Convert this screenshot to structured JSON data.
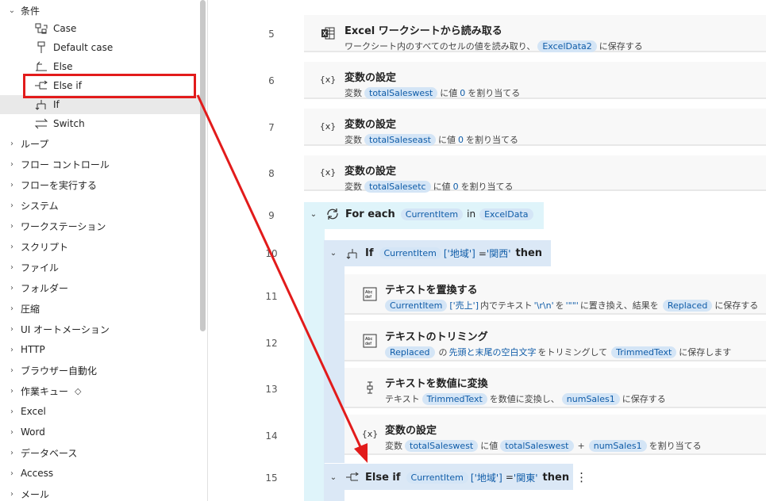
{
  "sidebar": {
    "conditions_label": "条件",
    "sub_items": [
      {
        "label": "Case",
        "icon": "case-icon"
      },
      {
        "label": "Default case",
        "icon": "default-case-icon"
      },
      {
        "label": "Else",
        "icon": "else-icon"
      },
      {
        "label": "Else if",
        "icon": "else-if-icon"
      },
      {
        "label": "If",
        "icon": "if-icon"
      },
      {
        "label": "Switch",
        "icon": "switch-icon"
      }
    ],
    "groups": [
      "ループ",
      "フロー コントロール",
      "フローを実行する",
      "システム",
      "ワークステーション",
      "スクリプト",
      "ファイル",
      "フォルダー",
      "圧縮",
      "UI オートメーション",
      "HTTP",
      "ブラウザー自動化",
      "作業キュー",
      "Excel",
      "Word",
      "データベース",
      "Access",
      "メール"
    ]
  },
  "main": {
    "line_numbers": [
      "5",
      "6",
      "7",
      "8",
      "9",
      "10",
      "11",
      "12",
      "13",
      "14",
      "15"
    ],
    "step5": {
      "title": "Excel ワークシートから読み取る",
      "desc_pre": "ワークシート内のすべてのセルの値を読み取り、",
      "var": "ExcelData2",
      "desc_post": "に保存する"
    },
    "step6": {
      "title": "変数の設定",
      "pre": "変数",
      "var": "totalSaleswest",
      "mid": "に値",
      "val": "0",
      "post": "を割り当てる"
    },
    "step7": {
      "title": "変数の設定",
      "pre": "変数",
      "var": "totalSaleseast",
      "mid": "に値",
      "val": "0",
      "post": "を割り当てる"
    },
    "step8": {
      "title": "変数の設定",
      "pre": "変数",
      "var": "totalSalesetc",
      "mid": "に値",
      "val": "0",
      "post": "を割り当てる"
    },
    "foreach": {
      "kw": "For each",
      "var": "CurrentItem",
      "in": "in",
      "list": "ExcelData"
    },
    "if": {
      "kw": "If",
      "var": "CurrentItem",
      "key": "['地域']",
      "op": "=",
      "value": "'関西'",
      "then": "then"
    },
    "step11": {
      "title": "テキストを置換する",
      "var": "CurrentItem",
      "key": "['売上']",
      "mid1": "内でテキスト",
      "find": "'\\r\\n'",
      "mid2": "を",
      "repl": "'\"\"'",
      "mid3": "に置き換え、結果を",
      "result": "Replaced",
      "post": "に保存する"
    },
    "step12": {
      "title": "テキストのトリミング",
      "var": "Replaced",
      "mid1": "の",
      "mode": "先頭と末尾の空白文字",
      "mid2": "をトリミングして",
      "result": "TrimmedText",
      "post": "に保存します"
    },
    "step13": {
      "title": "テキストを数値に変換",
      "pre": "テキスト",
      "var": "TrimmedText",
      "mid": "を数値に変換し、",
      "result": "numSales1",
      "post": "に保存する"
    },
    "step14": {
      "title": "変数の設定",
      "pre": "変数",
      "var": "totalSaleswest",
      "mid": "に値",
      "a": "totalSaleswest",
      "op": "+",
      "b": "numSales1",
      "post": "を割り当てる"
    },
    "elseif": {
      "kw": "Else if",
      "var": "CurrentItem",
      "key": "['地域']",
      "op": "=",
      "value": "'関東'",
      "then": "then",
      "more": "⋮"
    }
  },
  "colors": {
    "accent_red": "#e21b1b",
    "chip_bg": "#d4e5f6",
    "chip_text": "#0f5ca8"
  }
}
